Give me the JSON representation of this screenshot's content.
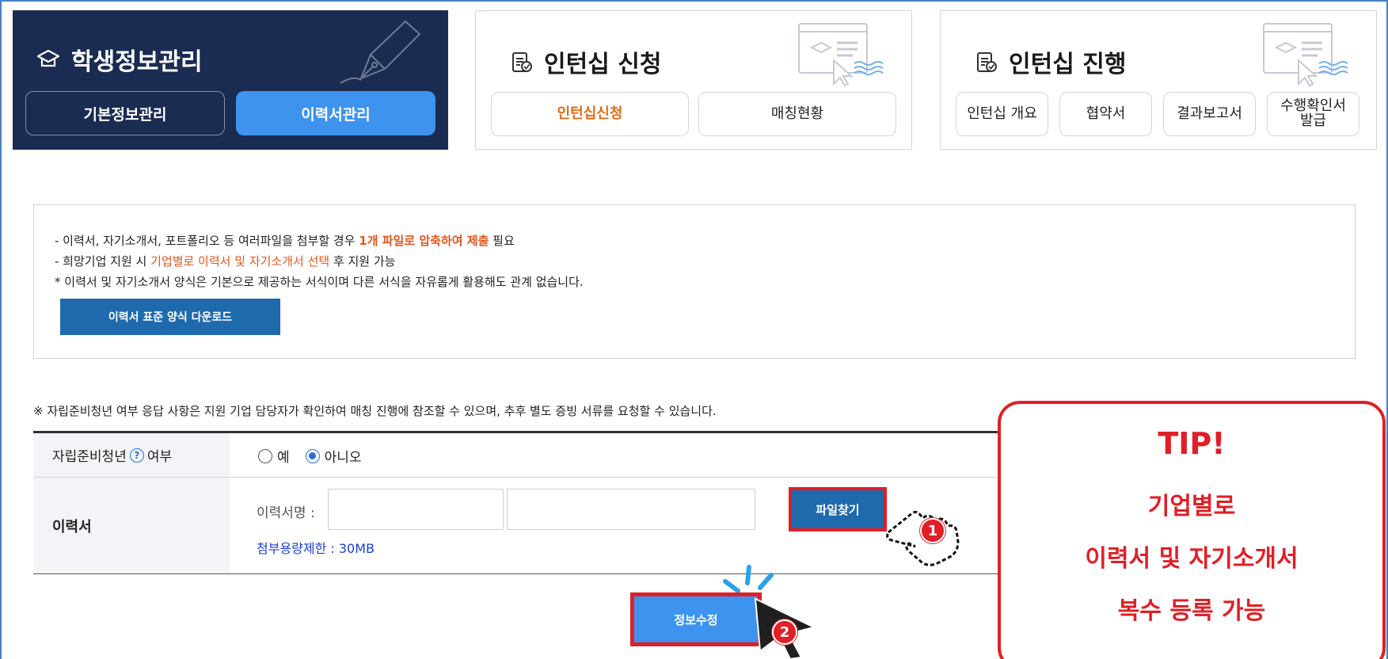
{
  "student_card": {
    "title": "학생정보관리",
    "buttons": [
      "기본정보관리",
      "이력서관리"
    ]
  },
  "apply_card": {
    "title": "인턴십 신청",
    "buttons": [
      "인턴십신청",
      "매칭현황"
    ]
  },
  "progress_card": {
    "title": "인턴십 진행",
    "buttons": [
      "인턴십 개요",
      "협약서",
      "결과보고서"
    ],
    "cert_line1": "수행확인서",
    "cert_line2": "발급"
  },
  "notice": {
    "line1_a": "- 이력서, 자기소개서, 포트폴리오 등 여러파일을 첨부할 경우 ",
    "line1_hl": "1개 파일로 압축하여 제출",
    "line1_b": " 필요",
    "line2_a": "- 희망기업 지원 시 ",
    "line2_hl": "기업별로 이력서 및 자기소개서 선택",
    "line2_b": " 후 지원 가능",
    "line3": "* 이력서 및 자기소개서 양식은 기본으로 제공하는 서식이며 다른 서식을 자유롭게 활용해도 관계 없습니다.",
    "download_label": "이력서 표준 양식 다운로드"
  },
  "note": "※ 자립준비청년 여부 응답 사항은 지원 기업 담당자가 확인하여 매칭 진행에 참조할 수 있으며, 추후 별도 증빙 서류를 요청할 수 있습니다.",
  "form": {
    "row1_label_a": "자립준비청년",
    "row1_help": "?",
    "row1_label_b": "여부",
    "option_yes": "예",
    "option_no": "아니오",
    "selected": "아니오",
    "row2_label": "이력서",
    "resume_name_label": "이력서명 :",
    "find_file_label": "파일찾기",
    "size_limit": "첨부용량제한 : 30MB"
  },
  "save_label": "정보수정",
  "tip": {
    "title": "TIP!",
    "line1": "기업별로",
    "line2": "이력서 및 자기소개서",
    "line3": "복수 등록 가능"
  },
  "steps": [
    "1",
    "2"
  ],
  "colors": {
    "navy": "#1b2c52",
    "blue": "#3d93ee",
    "dark_blue": "#1f6aad",
    "highlight_red": "#e01f26",
    "orange": "#e46b14"
  }
}
